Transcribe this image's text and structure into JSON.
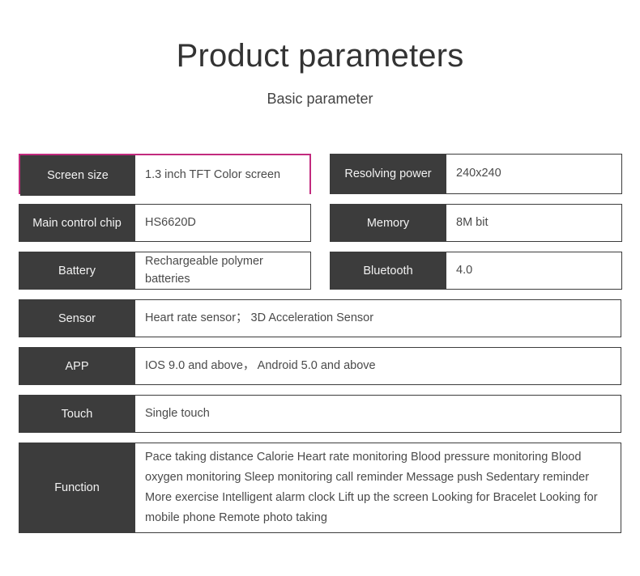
{
  "header": {
    "title": "Product parameters",
    "subtitle": "Basic parameter"
  },
  "colors": {
    "label_background": "#3c3c3c",
    "label_text": "#f2f2f2",
    "value_text": "#4a4a4a",
    "highlight_border": "#c22a7e",
    "page_background": "#ffffff"
  },
  "rows": {
    "screen_size": {
      "label": "Screen size",
      "value": "1.3  inch TFT Color screen",
      "highlighted": true
    },
    "resolving_power": {
      "label": "Resolving power",
      "value": "240x240"
    },
    "main_control_chip": {
      "label": "Main control chip",
      "value": "HS6620D"
    },
    "memory": {
      "label": "Memory",
      "value": "8M bit"
    },
    "battery": {
      "label": "Battery",
      "value": "Rechargeable polymer batteries"
    },
    "bluetooth": {
      "label": "Bluetooth",
      "value": "4.0"
    },
    "sensor": {
      "label": "Sensor",
      "value": "Heart rate sensor； 3D Acceleration Sensor"
    },
    "app": {
      "label": "APP",
      "value": "IOS 9.0 and above， Android 5.0 and above"
    },
    "touch": {
      "label": "Touch",
      "value": "Single touch"
    },
    "function": {
      "label": "Function",
      "value": "Pace taking  distance  Calorie  Heart rate monitoring  Blood pressure monitoring  Blood oxygen monitoring  Sleep monitoring  call reminder  Message push  Sedentary reminder  More exercise  Intelligent alarm clock Lift up the screen  Looking for Bracelet  Looking for mobile phone  Remote photo taking"
    }
  }
}
